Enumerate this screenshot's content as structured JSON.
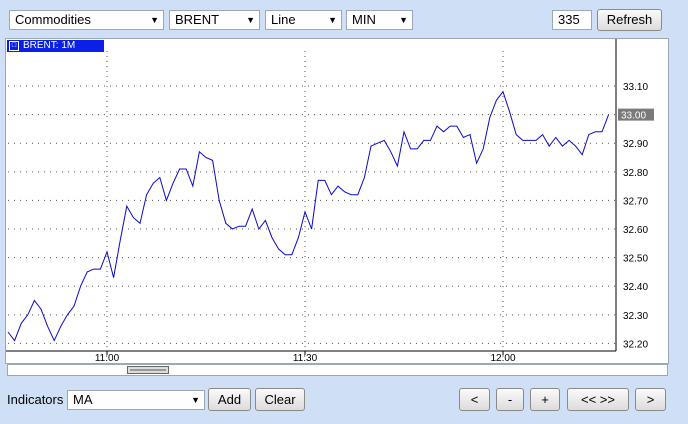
{
  "toolbar": {
    "market": "Commodities",
    "symbol": "BRENT",
    "chart_type": "Line",
    "interval": "MIN",
    "bars_count": "335",
    "refresh_label": "Refresh"
  },
  "chart_tag": "BRENT: 1M",
  "bottom": {
    "indicators_label": "Indicators",
    "indicator_value": "MA",
    "add_label": "Add",
    "clear_label": "Clear",
    "nav": [
      "<",
      "-",
      "+",
      "<< >>",
      ">"
    ]
  },
  "colors": {
    "line": "#0a0acc",
    "tag": "#0b20e6",
    "price_marker": "#7a7a7a"
  },
  "chart_data": {
    "type": "line",
    "title": "BRENT: 1M",
    "x_ticks": [
      "11:00",
      "11:30",
      "12:00"
    ],
    "y_ticks": [
      "33.10",
      "33.00",
      "32.90",
      "32.80",
      "32.70",
      "32.60",
      "32.50",
      "32.40",
      "32.30",
      "32.20"
    ],
    "current_price_label": "33.00",
    "ylim": [
      32.17,
      33.17
    ],
    "grid": true,
    "series": [
      {
        "x": [
          "10:45",
          "10:46",
          "10:47",
          "10:48",
          "10:49",
          "10:50",
          "10:51",
          "10:52",
          "10:53",
          "10:54",
          "10:55",
          "10:56",
          "10:57",
          "10:58",
          "10:59",
          "11:00",
          "11:01",
          "11:02",
          "11:03",
          "11:04",
          "11:05",
          "11:06",
          "11:07",
          "11:08",
          "11:09",
          "11:10",
          "11:11",
          "11:12",
          "11:13",
          "11:14",
          "11:15",
          "11:16",
          "11:17",
          "11:18",
          "11:19",
          "11:20",
          "11:21",
          "11:22",
          "11:23",
          "11:24",
          "11:25",
          "11:26",
          "11:27",
          "11:28",
          "11:29",
          "11:30",
          "11:31",
          "11:32",
          "11:33",
          "11:34",
          "11:35",
          "11:36",
          "11:37",
          "11:38",
          "11:39",
          "11:40",
          "11:41",
          "11:42",
          "11:43",
          "11:44",
          "11:45",
          "11:46",
          "11:47",
          "11:48",
          "11:49",
          "11:50",
          "11:51",
          "11:52",
          "11:53",
          "11:54",
          "11:55",
          "11:56",
          "11:57",
          "11:58",
          "11:59",
          "12:00",
          "12:01",
          "12:02",
          "12:03",
          "12:04",
          "12:05",
          "12:06",
          "12:07",
          "12:08",
          "12:09",
          "12:10",
          "12:11",
          "12:12",
          "12:13",
          "12:14",
          "12:15",
          "12:16"
        ],
        "values": [
          32.24,
          32.21,
          32.27,
          32.3,
          32.35,
          32.32,
          32.26,
          32.21,
          32.26,
          32.3,
          32.33,
          32.4,
          32.45,
          32.46,
          32.46,
          32.52,
          32.43,
          32.56,
          32.68,
          32.64,
          32.62,
          32.72,
          32.76,
          32.78,
          32.7,
          32.76,
          32.81,
          32.81,
          32.75,
          32.87,
          32.85,
          32.84,
          32.7,
          32.62,
          32.6,
          32.61,
          32.61,
          32.67,
          32.6,
          32.63,
          32.57,
          32.53,
          32.51,
          32.51,
          32.57,
          32.66,
          32.6,
          32.77,
          32.77,
          32.72,
          32.75,
          32.73,
          32.72,
          32.72,
          32.78,
          32.89,
          32.9,
          32.91,
          32.87,
          32.82,
          32.94,
          32.88,
          32.88,
          32.91,
          32.91,
          32.96,
          32.94,
          32.96,
          32.96,
          32.92,
          32.93,
          32.83,
          32.88,
          32.99,
          33.05,
          33.08,
          33.01,
          32.93,
          32.91,
          32.91,
          32.91,
          32.93,
          32.89,
          32.92,
          32.89,
          32.91,
          32.89,
          32.86,
          32.93,
          32.94,
          32.94,
          33.0
        ]
      }
    ]
  }
}
